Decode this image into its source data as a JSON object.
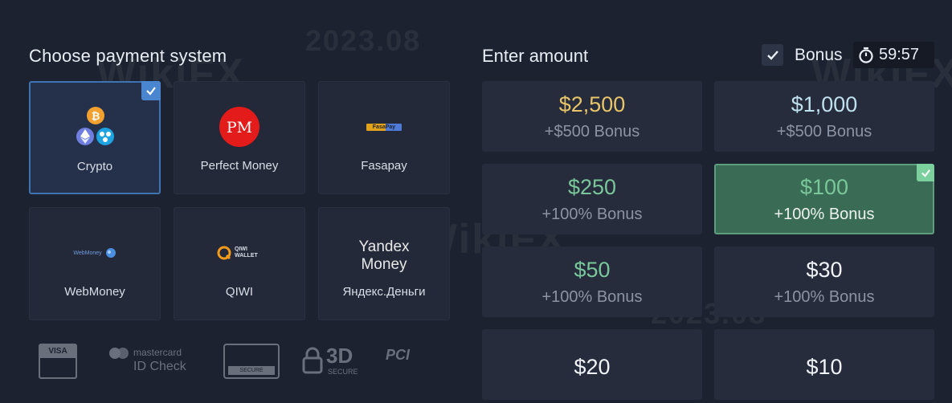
{
  "payment": {
    "title": "Choose payment system",
    "methods": [
      {
        "label": "Crypto",
        "selected": true,
        "icon": "crypto-icon"
      },
      {
        "label": "Perfect Money",
        "selected": false,
        "icon": "perfect-money-icon",
        "logo_text": "PM"
      },
      {
        "label": "Fasapay",
        "selected": false,
        "icon": "fasapay-icon",
        "logo_text": "FasaPay"
      },
      {
        "label": "WebMoney",
        "selected": false,
        "icon": "webmoney-icon",
        "logo_text": "WebMoney"
      },
      {
        "label": "QIWI",
        "selected": false,
        "icon": "qiwi-icon",
        "logo_text": "QIWI WALLET"
      },
      {
        "label": "Яндекс.Деньги",
        "selected": false,
        "icon": "yandex-money-icon",
        "logo_text_1": "Yandex",
        "logo_text_2": "Money"
      }
    ],
    "security_badges": [
      {
        "name": "visa-badge",
        "text": "VISA"
      },
      {
        "name": "mastercard-id-check-badge",
        "text_1": "mastercard",
        "text_2": "ID Check"
      },
      {
        "name": "secure-badge",
        "text": "SECURE"
      },
      {
        "name": "3d-secure-badge",
        "text_1": "3D",
        "text_2": "SECURE"
      },
      {
        "name": "pci-dss-badge",
        "text": "PCI"
      }
    ]
  },
  "amount": {
    "title": "Enter amount",
    "bonus_checked": true,
    "bonus_label": "Bonus",
    "timer": "59:57",
    "options": [
      {
        "value": "$2,500",
        "bonus": "+$500 Bonus",
        "color": "#e9c56a",
        "selected": false
      },
      {
        "value": "$1,000",
        "bonus": "+$500 Bonus",
        "color": "#bfe0ee",
        "selected": false
      },
      {
        "value": "$250",
        "bonus": "+100% Bonus",
        "color": "#79c79a",
        "selected": false
      },
      {
        "value": "$100",
        "bonus": "+100% Bonus",
        "color": "#79c79a",
        "selected": true
      },
      {
        "value": "$50",
        "bonus": "+100% Bonus",
        "color": "#79c79a",
        "selected": false
      },
      {
        "value": "$30",
        "bonus": "+100% Bonus",
        "color": "#f0f3f7",
        "selected": false
      },
      {
        "value": "$20",
        "bonus": "",
        "color": "#f0f3f7",
        "selected": false
      },
      {
        "value": "$10",
        "bonus": "",
        "color": "#f0f3f7",
        "selected": false
      }
    ]
  },
  "watermark": {
    "brand": "WikiFX",
    "date": "2023.08"
  },
  "colors": {
    "background": "#1d2230",
    "accent_blue": "#4a86cf",
    "selected_green": "#3a6b55"
  }
}
